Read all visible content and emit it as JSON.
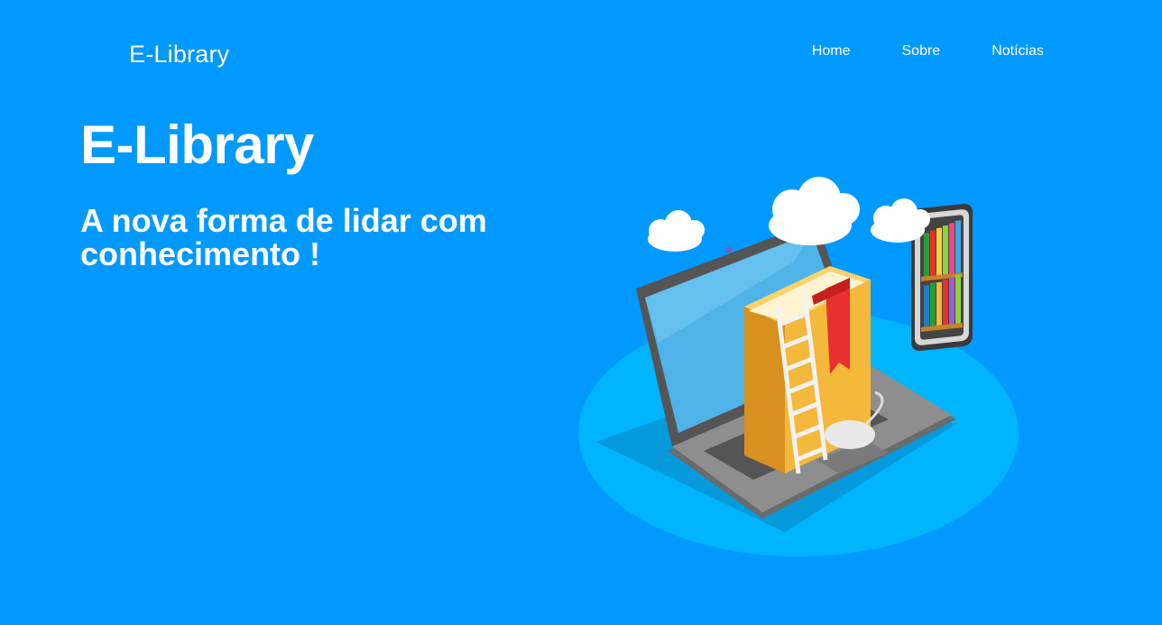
{
  "header": {
    "logo_text": "E-Library",
    "nav": [
      {
        "label": "Home"
      },
      {
        "label": "Sobre"
      },
      {
        "label": "Notícias"
      }
    ]
  },
  "hero": {
    "title": "E-Library",
    "subtitle": "A nova forma de lidar com conhecimento !"
  },
  "illustration": {
    "description_icon": "laptop-books-illustration"
  },
  "colors": {
    "background": "#0099ff",
    "text": "#ffffff",
    "platform": "#00b4ff",
    "book": "#f4b83a",
    "bookmark": "#e8302f"
  }
}
